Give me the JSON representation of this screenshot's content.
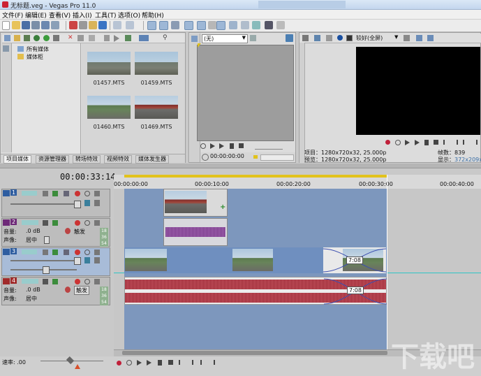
{
  "window": {
    "title": "无标题.veg - Vegas Pro 11.0"
  },
  "menu": [
    "文件(F)",
    "编辑(E)",
    "查看(V)",
    "插入(I)",
    "工具(T)",
    "选项(O)",
    "帮助(H)"
  ],
  "explorer": {
    "tree": [
      "所有媒体",
      "媒体柜"
    ],
    "items": [
      {
        "name": "01457.MTS",
        "style": "street"
      },
      {
        "name": "01459.MTS",
        "style": "street"
      },
      {
        "name": "01460.MTS",
        "style": "road"
      },
      {
        "name": "01469.MTS",
        "style": "red"
      }
    ],
    "tabs": [
      "项目媒体",
      "资源管理器",
      "转场特效",
      "视频特效",
      "媒体发生器"
    ]
  },
  "trimmer": {
    "dropdown": "(无)",
    "timecode": "00:00:00:00"
  },
  "preview": {
    "quality": "较好(全屏)",
    "project_label": "项目：",
    "project_value": "1280x720x32, 25.000p",
    "preview_label": "预览：",
    "preview_value": "1280x720x32, 25.000p",
    "frame_label": "帧数：",
    "frame_value": "839",
    "display_label": "显示：",
    "display_value": "372x209x3"
  },
  "timeline": {
    "current_time": "00:00:33:14",
    "ruler": [
      "00:00:00:00",
      "00:00:10:00",
      "00:00:20:00",
      "00:00:30:00",
      "00:00:40:00"
    ],
    "tracks": [
      {
        "num": "1",
        "type": "video"
      },
      {
        "num": "2",
        "type": "audio",
        "volume_label": "音量:",
        "volume": ".0 dB",
        "pan_label": "声像:",
        "pan": "居中",
        "mode": "触发",
        "meter": [
          "18",
          "36",
          "54"
        ]
      },
      {
        "num": "3",
        "type": "video"
      },
      {
        "num": "4",
        "type": "audio",
        "volume_label": "音量:",
        "volume": ".0 dB",
        "pan_label": "声像:",
        "pan": "居中",
        "mode": "触发",
        "meter": [
          "18",
          "36",
          "54"
        ]
      }
    ],
    "fade_label": "7:08",
    "rate_label": "速率: .00"
  },
  "watermark": "下载吧"
}
